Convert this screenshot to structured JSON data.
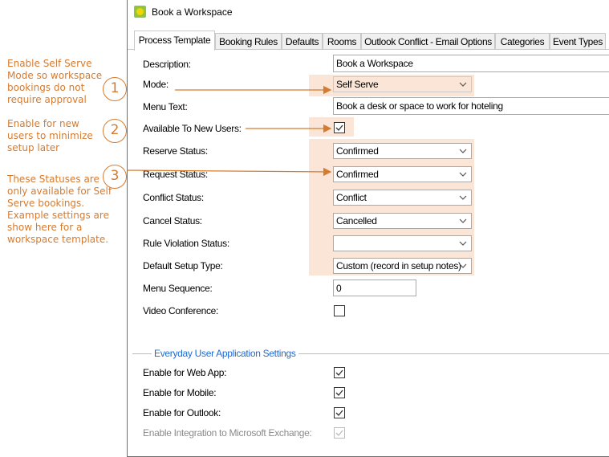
{
  "window": {
    "title": "Book a Workspace"
  },
  "tabs": [
    "Process Template",
    "Booking Rules",
    "Defaults",
    "Rooms",
    "Outlook Conflict - Email Options",
    "Categories",
    "Event Types"
  ],
  "form": {
    "description": {
      "label": "Description:",
      "value": "Book a Workspace"
    },
    "mode": {
      "label": "Mode:",
      "value": "Self Serve"
    },
    "menu_text": {
      "label": "Menu Text:",
      "value": "Book a desk or space to work for hoteling"
    },
    "available_to_new_users": {
      "label": "Available To New Users:",
      "checked": true
    },
    "reserve_status": {
      "label": "Reserve Status:",
      "value": "Confirmed"
    },
    "request_status": {
      "label": "Request Status:",
      "value": "Confirmed"
    },
    "conflict_status": {
      "label": "Conflict Status:",
      "value": "Conflict"
    },
    "cancel_status": {
      "label": "Cancel Status:",
      "value": "Cancelled"
    },
    "rule_violation_status": {
      "label": "Rule Violation Status:",
      "value": ""
    },
    "default_setup_type": {
      "label": "Default Setup Type:",
      "value": "Custom (record in setup notes)"
    },
    "menu_sequence": {
      "label": "Menu Sequence:",
      "value": "0"
    },
    "video_conference": {
      "label": "Video Conference:",
      "checked": false
    }
  },
  "everyday_settings": {
    "group_label": "Everyday User Application Settings",
    "web_app": {
      "label": "Enable for Web App:",
      "checked": true
    },
    "mobile": {
      "label": "Enable for Mobile:",
      "checked": true
    },
    "outlook": {
      "label": "Enable for Outlook:",
      "checked": true
    },
    "exchange": {
      "label": "Enable Integration to Microsoft Exchange:",
      "checked": true,
      "disabled": true
    }
  },
  "annotations": [
    {
      "number": "1",
      "text": "Enable Self Serve Mode so workspace bookings do not require approval"
    },
    {
      "number": "2",
      "text": "Enable for new users to minimize setup later"
    },
    {
      "number": "3",
      "text": "These Statuses are only available for Self Serve bookings. Example settings are show here for a workspace template."
    }
  ],
  "colors": {
    "annotation": "#d67b2f",
    "highlight": "#fbe5d6",
    "group_label": "#1e6bd1"
  }
}
